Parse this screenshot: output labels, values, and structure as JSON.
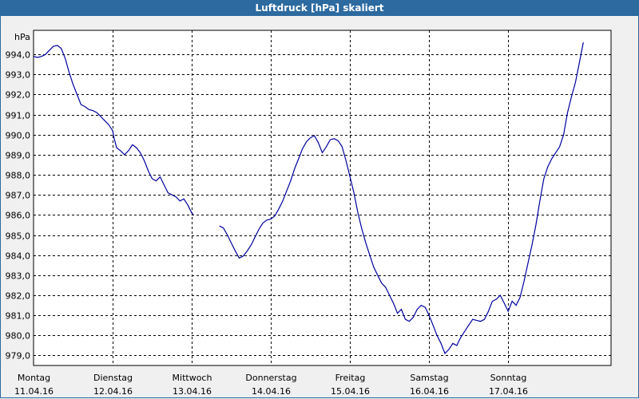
{
  "window": {
    "title": "Luftdruck [hPa] skaliert"
  },
  "colors": {
    "titlebar": "#2c6aa0",
    "plot_bg": "#ffffff",
    "line": "#0000a0",
    "grid": "#000000"
  },
  "chart_data": {
    "type": "line",
    "title": "Luftdruck [hPa] skaliert",
    "ylabel": "hPa",
    "ylim": [
      978.5,
      995.2
    ],
    "xlim": [
      0,
      7.3
    ],
    "grid": true,
    "y_ticks": [
      "979,0",
      "980,0",
      "981,0",
      "982,0",
      "983,0",
      "984,0",
      "985,0",
      "986,0",
      "987,0",
      "988,0",
      "989,0",
      "990,0",
      "991,0",
      "992,0",
      "993,0",
      "994,0"
    ],
    "y_tick_values": [
      979,
      980,
      981,
      982,
      983,
      984,
      985,
      986,
      987,
      988,
      989,
      990,
      991,
      992,
      993,
      994
    ],
    "x_ticks": [
      {
        "day": "Montag",
        "date": "11.04.16"
      },
      {
        "day": "Dienstag",
        "date": "12.04.16"
      },
      {
        "day": "Mittwoch",
        "date": "13.04.16"
      },
      {
        "day": "Donnerstag",
        "date": "14.04.16"
      },
      {
        "day": "Freitag",
        "date": "15.04.16"
      },
      {
        "day": "Samstag",
        "date": "16.04.16"
      },
      {
        "day": "Sonntag",
        "date": "17.04.16"
      }
    ],
    "series": [
      {
        "segments": [
          [
            [
              0.0,
              993.9
            ],
            [
              0.05,
              993.85
            ],
            [
              0.1,
              993.9
            ],
            [
              0.15,
              994.0
            ],
            [
              0.2,
              994.2
            ],
            [
              0.25,
              994.4
            ],
            [
              0.3,
              994.45
            ],
            [
              0.35,
              994.3
            ],
            [
              0.4,
              993.8
            ],
            [
              0.45,
              993.1
            ],
            [
              0.5,
              992.5
            ],
            [
              0.55,
              992.0
            ],
            [
              0.6,
              991.5
            ],
            [
              0.65,
              991.4
            ],
            [
              0.7,
              991.25
            ],
            [
              0.75,
              991.2
            ],
            [
              0.8,
              991.1
            ],
            [
              0.85,
              990.9
            ],
            [
              0.9,
              990.7
            ],
            [
              0.95,
              990.5
            ],
            [
              1.0,
              990.2
            ],
            [
              1.02,
              989.8
            ],
            [
              1.05,
              989.35
            ],
            [
              1.1,
              989.2
            ],
            [
              1.15,
              989.0
            ],
            [
              1.2,
              989.2
            ],
            [
              1.25,
              989.5
            ],
            [
              1.3,
              989.35
            ],
            [
              1.35,
              989.1
            ],
            [
              1.4,
              988.7
            ],
            [
              1.45,
              988.2
            ],
            [
              1.5,
              987.8
            ],
            [
              1.55,
              987.7
            ],
            [
              1.6,
              987.9
            ],
            [
              1.65,
              987.5
            ],
            [
              1.7,
              987.1
            ],
            [
              1.75,
              987.0
            ],
            [
              1.8,
              986.9
            ],
            [
              1.85,
              986.7
            ],
            [
              1.9,
              986.8
            ],
            [
              1.95,
              986.5
            ],
            [
              2.0,
              986.1
            ],
            [
              2.02,
              986.0
            ]
          ],
          [
            [
              2.35,
              985.45
            ],
            [
              2.4,
              985.35
            ],
            [
              2.45,
              985.0
            ],
            [
              2.5,
              984.6
            ],
            [
              2.55,
              984.2
            ],
            [
              2.6,
              983.85
            ],
            [
              2.65,
              983.95
            ],
            [
              2.7,
              984.2
            ],
            [
              2.75,
              984.5
            ],
            [
              2.8,
              984.9
            ],
            [
              2.85,
              985.3
            ],
            [
              2.9,
              985.6
            ],
            [
              2.95,
              985.75
            ],
            [
              3.0,
              985.8
            ],
            [
              3.05,
              985.95
            ],
            [
              3.1,
              986.3
            ],
            [
              3.15,
              986.7
            ],
            [
              3.2,
              987.2
            ],
            [
              3.25,
              987.7
            ],
            [
              3.3,
              988.3
            ],
            [
              3.35,
              988.8
            ],
            [
              3.4,
              989.3
            ],
            [
              3.45,
              989.65
            ],
            [
              3.5,
              989.85
            ],
            [
              3.55,
              989.95
            ],
            [
              3.6,
              989.6
            ],
            [
              3.65,
              989.1
            ],
            [
              3.7,
              989.4
            ],
            [
              3.75,
              989.75
            ],
            [
              3.8,
              989.8
            ],
            [
              3.85,
              989.7
            ],
            [
              3.9,
              989.4
            ],
            [
              3.95,
              988.7
            ],
            [
              4.0,
              987.9
            ],
            [
              4.05,
              987.1
            ],
            [
              4.1,
              986.1
            ],
            [
              4.15,
              985.3
            ],
            [
              4.2,
              984.6
            ],
            [
              4.25,
              984.0
            ],
            [
              4.3,
              983.4
            ],
            [
              4.35,
              983.0
            ],
            [
              4.4,
              982.6
            ],
            [
              4.45,
              982.4
            ],
            [
              4.5,
              982.0
            ],
            [
              4.55,
              981.6
            ],
            [
              4.6,
              981.1
            ],
            [
              4.65,
              981.3
            ],
            [
              4.7,
              980.8
            ],
            [
              4.75,
              980.7
            ],
            [
              4.8,
              980.9
            ],
            [
              4.85,
              981.3
            ],
            [
              4.9,
              981.5
            ],
            [
              4.95,
              981.4
            ],
            [
              5.0,
              981.0
            ],
            [
              5.05,
              980.5
            ],
            [
              5.1,
              980.0
            ],
            [
              5.15,
              979.6
            ],
            [
              5.2,
              979.1
            ],
            [
              5.25,
              979.3
            ],
            [
              5.3,
              979.6
            ],
            [
              5.35,
              979.5
            ],
            [
              5.4,
              979.9
            ],
            [
              5.45,
              980.2
            ],
            [
              5.5,
              980.5
            ],
            [
              5.55,
              980.8
            ],
            [
              5.6,
              980.75
            ],
            [
              5.65,
              980.7
            ],
            [
              5.7,
              980.8
            ],
            [
              5.75,
              981.2
            ],
            [
              5.8,
              981.7
            ],
            [
              5.85,
              981.8
            ],
            [
              5.9,
              982.0
            ],
            [
              5.95,
              981.6
            ],
            [
              6.0,
              981.2
            ],
            [
              6.05,
              981.7
            ],
            [
              6.1,
              981.5
            ],
            [
              6.15,
              981.9
            ],
            [
              6.2,
              982.7
            ],
            [
              6.25,
              983.6
            ],
            [
              6.3,
              984.5
            ],
            [
              6.35,
              985.5
            ],
            [
              6.4,
              986.7
            ],
            [
              6.45,
              987.8
            ],
            [
              6.5,
              988.4
            ],
            [
              6.55,
              988.8
            ],
            [
              6.6,
              989.1
            ],
            [
              6.65,
              989.4
            ],
            [
              6.7,
              990.0
            ],
            [
              6.75,
              991.1
            ],
            [
              6.8,
              991.9
            ],
            [
              6.85,
              992.6
            ],
            [
              6.9,
              993.6
            ],
            [
              6.95,
              994.6
            ]
          ]
        ]
      }
    ]
  }
}
